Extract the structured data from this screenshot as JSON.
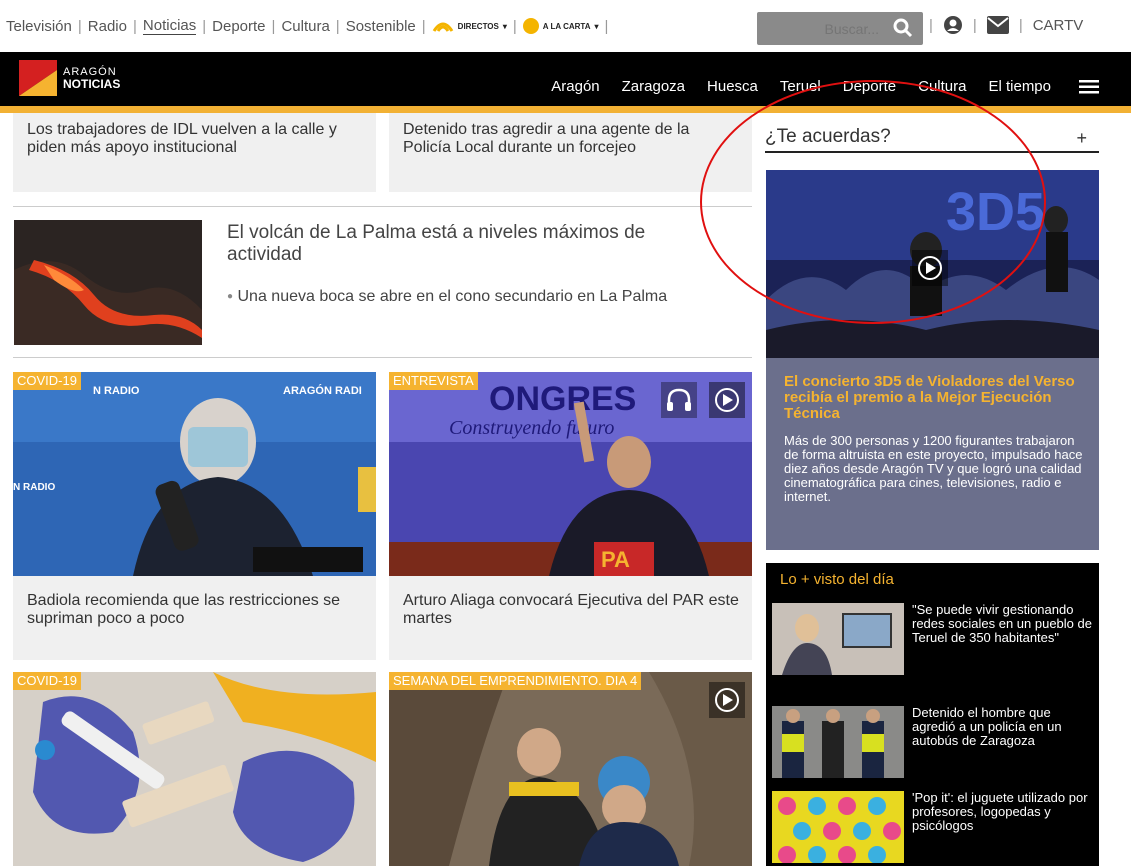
{
  "topbar": {
    "links": [
      "Televisión",
      "Radio",
      "Noticias",
      "Deporte",
      "Cultura",
      "Sostenible"
    ],
    "active": "Noticias",
    "directos": "DIRECTOS",
    "alacarta": "A LA CARTA",
    "search_placeholder": "Buscar...",
    "cartv": "CARTV"
  },
  "logo": {
    "line1": "ARAGÓN",
    "line2": "NOTICIAS"
  },
  "nav": {
    "items": [
      "Aragón",
      "Zaragoza",
      "Huesca",
      "Teruel",
      "Deporte",
      "Cultura",
      "El tiempo"
    ]
  },
  "news": {
    "top_left": "Los trabajadores de IDL vuelven a la calle y piden más apoyo institucional",
    "top_right": "Detenido tras agredir a una agente de la Policía Local durante un forcejeo",
    "volcano_title": "El volcán de La Palma está a niveles máximos de actividad",
    "volcano_sub": "Una nueva boca se abre en el cono secundario en La Palma",
    "c1_tag": "COVID-19",
    "c1_caption": "Badiola recomienda que las restricciones se supriman poco a poco",
    "c1_overlay_left": "N RADIO",
    "c1_overlay_right": "ARAGÓN RADI",
    "c1_overlay_mid": "N RADIO",
    "c2_tag": "ENTREVISTA",
    "c2_caption": "Arturo Aliaga convocará Ejecutiva del PAR este martes",
    "c2_overlay_big": "ONGRES",
    "c2_overlay_script": "Construyendo futuro",
    "c2_overlay_pa": "PA",
    "c3_tag": "COVID-19",
    "c4_tag": "SEMANA DEL EMPRENDIMIENTO. DIA 4"
  },
  "aside": {
    "title": "¿Te acuerdas?",
    "plus": "+",
    "feature_title": "El concierto 3D5 de Violadores del Verso recibía el premio a la Mejor Ejecución Técnica",
    "feature_text": "Más de 300 personas y 1200 figurantes trabajaron de forma altruista en este proyecto, impulsado hace diez años desde Aragón TV y que logró una calidad cinematográfica para cines, televisiones, radio e internet.",
    "feature_overlay": "3D5",
    "most_title": "Lo + visto del día",
    "most": [
      "\"Se puede vivir gestionando redes sociales en un pueblo de Teruel de 350 habitantes\"",
      "Detenido el hombre que agredió a un policía en un autobús de Zaragoza",
      "'Pop it': el juguete utilizado por profesores, logopedas y psicólogos"
    ]
  },
  "colors": {
    "accent": "#f5b330",
    "nav_bg": "#000000",
    "feature_bg": "#6b6f8c",
    "circle": "#e01010"
  }
}
